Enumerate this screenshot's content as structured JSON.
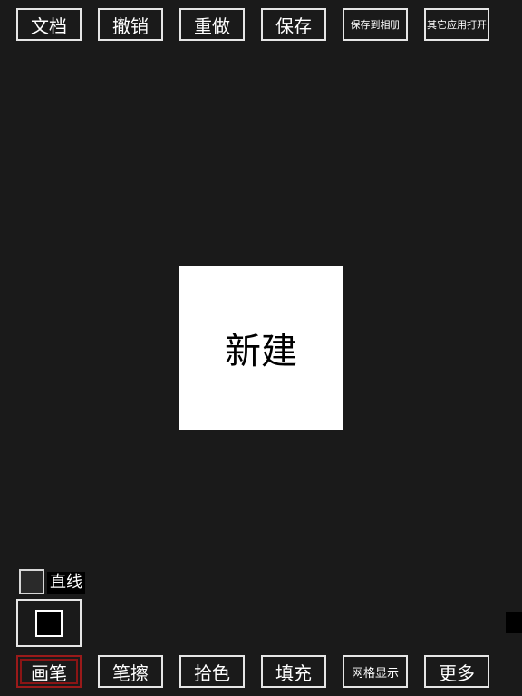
{
  "toolbar_top": {
    "document": "文档",
    "undo": "撤销",
    "redo": "重做",
    "save": "保存",
    "save_to_album": "保存到相册",
    "open_in_other_app": "其它应用打开"
  },
  "canvas": {
    "new_label": "新建"
  },
  "options": {
    "straight_line_label": "直线",
    "straight_line_checked": false,
    "current_color": "#000000"
  },
  "toolbar_bottom": {
    "brush": "画笔",
    "eraser": "笔擦",
    "color_picker": "拾色",
    "fill": "填充",
    "grid_display": "网格显示",
    "more": "更多",
    "selected_tool": "brush"
  },
  "theme": {
    "background": "#1a1a1a",
    "button_border": "#e6e6e6",
    "selected_border": "#8a1515"
  }
}
